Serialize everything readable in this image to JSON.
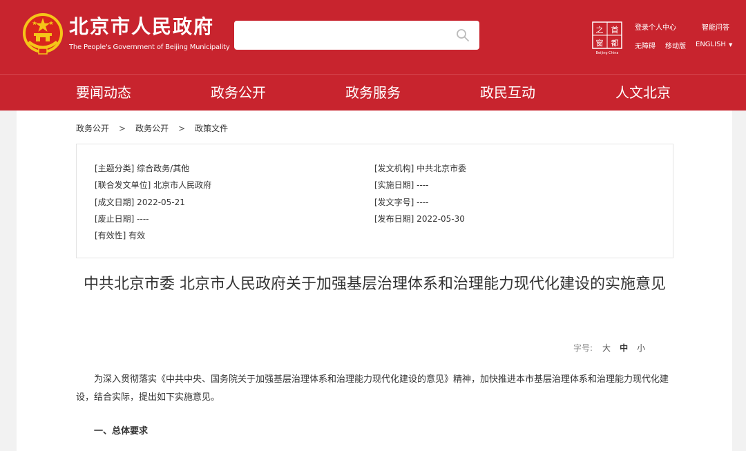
{
  "header": {
    "logo_cn": "北京市人民政府",
    "logo_en": "The People's Government of Beijing Municipality",
    "search": {
      "value": "",
      "placeholder": ""
    },
    "capital_logo_text": [
      "之",
      "首",
      "窗",
      "都"
    ],
    "capital_logo_en": "Beijing·China",
    "links": {
      "login": "登录个人中心",
      "smart_qa": "智能问答",
      "accessible": "无障碍",
      "mobile": "移动版",
      "english": "ENGLISH"
    }
  },
  "nav": {
    "items": [
      "要闻动态",
      "政务公开",
      "政务服务",
      "政民互动",
      "人文北京"
    ]
  },
  "breadcrumb": [
    "政务公开",
    "政务公开",
    "政策文件"
  ],
  "breadcrumb_sep": ">",
  "meta": {
    "subject": "[主题分类] 综合政务/其他",
    "joint_issuer": "[联合发文单位] 北京市人民政府",
    "written_date": "[成文日期] 2022-05-21",
    "abolish_date": "[废止日期] ----",
    "validity": "[有效性] 有效",
    "issuing_org": "[发文机构] 中共北京市委",
    "effective_date": "[实施日期] ----",
    "doc_number": "[发文字号] ----",
    "publish_date": "[发布日期] 2022-05-30"
  },
  "document": {
    "title": "中共北京市委 北京市人民政府关于加强基层治理体系和治理能力现代化建设的实施意见",
    "font_size_label": "字号:",
    "font_sizes": [
      "大",
      "中",
      "小"
    ],
    "active_font_size": "中",
    "intro": "为深入贯彻落实《中共中央、国务院关于加强基层治理体系和治理能力现代化建设的意见》精神，加快推进本市基层治理体系和治理能力现代化建设，结合实际，提出如下实施意见。",
    "section1": "一、总体要求"
  },
  "colors": {
    "brand_red": "#c8242e",
    "emblem_gold": "#f5c518",
    "emblem_red": "#d9261c"
  }
}
